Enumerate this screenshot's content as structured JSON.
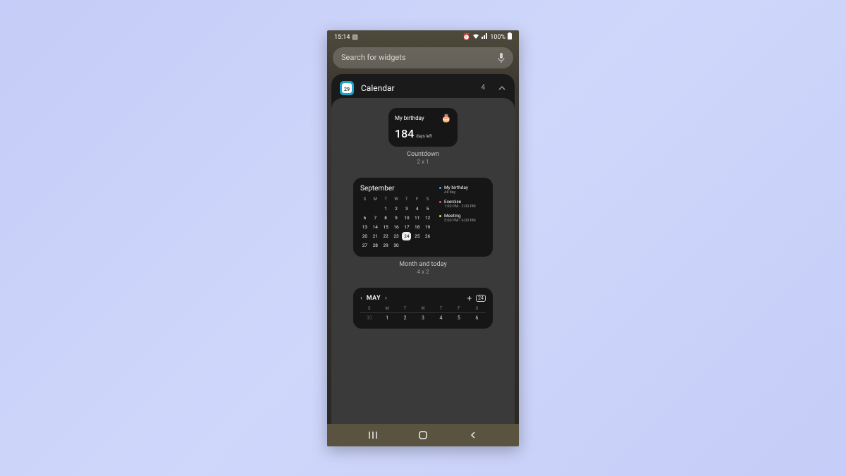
{
  "statusbar": {
    "time": "15:14",
    "battery_pct": "100%"
  },
  "search": {
    "placeholder": "Search for widgets"
  },
  "section": {
    "title": "Calendar",
    "count": "4",
    "icon_day": "29"
  },
  "countdown_widget": {
    "title": "My birthday",
    "emoji": "🎂",
    "number": "184",
    "unit": "days left",
    "caption": "Countdown",
    "dims": "2 x 1"
  },
  "month_widget": {
    "month": "September",
    "dow": [
      "S",
      "M",
      "T",
      "W",
      "T",
      "F",
      "S"
    ],
    "weeks": [
      [
        "",
        "",
        "1",
        "2",
        "3",
        "4",
        "5"
      ],
      [
        "6",
        "7",
        "8",
        "9",
        "10",
        "11",
        "12"
      ],
      [
        "13",
        "14",
        "15",
        "16",
        "17",
        "18",
        "19"
      ],
      [
        "20",
        "21",
        "22",
        "23",
        "24",
        "25",
        "26"
      ],
      [
        "27",
        "28",
        "29",
        "30",
        "",
        "",
        ""
      ]
    ],
    "today": "24",
    "events": [
      {
        "dot": "#4aa3ff",
        "title": "My birthday",
        "sub": "All day"
      },
      {
        "dot": "#ff4a4a",
        "title": "Exercise",
        "sub": "1:00 PM - 2:00 PM"
      },
      {
        "dot": "#c8e04a",
        "title": "Meeting",
        "sub": "5:00 PM - 6:00 PM"
      }
    ],
    "caption": "Month and today",
    "dims": "4 x 2"
  },
  "month2_widget": {
    "label": "MAY",
    "today": "24",
    "dow": [
      "S",
      "M",
      "T",
      "W",
      "T",
      "F",
      "S"
    ],
    "row": [
      "30",
      "1",
      "2",
      "3",
      "4",
      "5",
      "6"
    ]
  }
}
